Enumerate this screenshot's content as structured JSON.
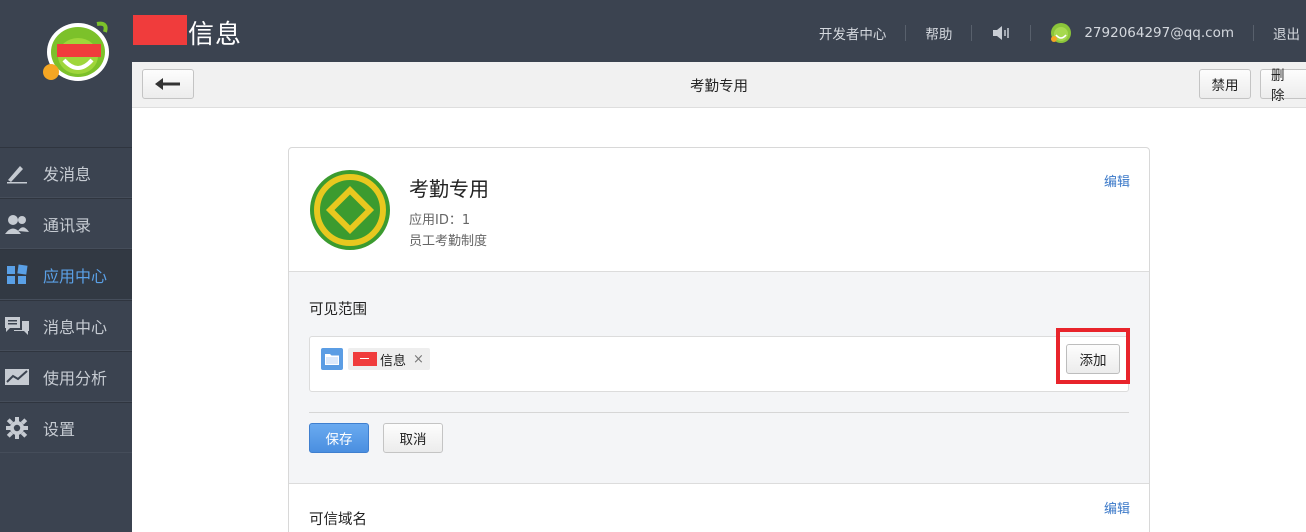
{
  "header": {
    "brand_title": "信息",
    "nav": {
      "developer_center": "开发者中心",
      "help": "帮助",
      "speaker_icon": "speaker-icon",
      "user_email": "2792064297@qq.com",
      "logout": "退出"
    }
  },
  "sidebar": {
    "items": [
      {
        "label": "发消息",
        "icon": "pencil-icon",
        "active": false
      },
      {
        "label": "通讯录",
        "icon": "contacts-icon",
        "active": false
      },
      {
        "label": "应用中心",
        "icon": "apps-grid-icon",
        "active": true
      },
      {
        "label": "消息中心",
        "icon": "chat-bubbles-icon",
        "active": false
      },
      {
        "label": "使用分析",
        "icon": "chart-icon",
        "active": false
      },
      {
        "label": "设置",
        "icon": "gear-icon",
        "active": false
      }
    ]
  },
  "toolbar": {
    "title": "考勤专用",
    "disable_label": "禁用",
    "delete_label": "删除"
  },
  "app": {
    "name": "考勤专用",
    "id_text": "应用ID：1",
    "description": "员工考勤制度",
    "edit_label": "编辑"
  },
  "scope": {
    "title": "可见范围",
    "tag_label": "信息",
    "tag_remove": "×",
    "add_label": "添加",
    "save_label": "保存",
    "cancel_label": "取消"
  },
  "domain": {
    "title": "可信域名",
    "edit_label": "编辑"
  },
  "colors": {
    "accent": "#5aa0e6",
    "header_bg": "#3b4350",
    "highlight": "#e8242b",
    "redaction": "#f03c3c"
  }
}
